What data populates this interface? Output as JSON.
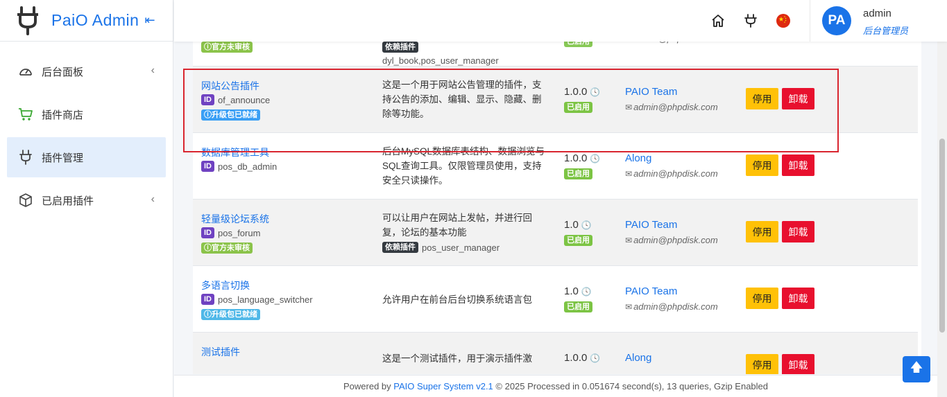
{
  "brand": {
    "title": "PaiO Admin",
    "collapse_icon": "collapse-left-icon"
  },
  "sidebar": {
    "items": [
      {
        "label": "后台面板",
        "icon": "dashboard-icon",
        "has_chevron": true
      },
      {
        "label": "插件商店",
        "icon": "cart-icon",
        "has_chevron": false
      },
      {
        "label": "插件管理",
        "icon": "plug-icon",
        "has_chevron": false,
        "active": true
      },
      {
        "label": "已启用插件",
        "icon": "box-icon",
        "has_chevron": true
      }
    ]
  },
  "header": {
    "icons": [
      "home-icon",
      "plug-icon",
      "china-flag-icon"
    ],
    "user": {
      "avatar_text": "PA",
      "name": "admin",
      "role": "后台管理员"
    }
  },
  "plugins": {
    "top_partial": {
      "review_badge": "ⓘ官方未审核",
      "dep_badge": "依赖插件",
      "dep_value": "dyl_book,pos_user_manager"
    },
    "labels": {
      "id_badge": "ID",
      "dep_badge": "依赖插件",
      "enabled_badge": "已启用",
      "disable_btn": "停用",
      "uninstall_btn": "卸载",
      "email_icon": "envelope-icon",
      "clock_icon": "clock-icon"
    },
    "rows": [
      {
        "name": "网站公告插件",
        "id": "of_announce",
        "status_badge": "ⓘ升级包已就绪",
        "description": "这是一个用于网站公告管理的插件，支持公告的添加、编辑、显示、隐藏、删除等功能。",
        "dependency": "",
        "version": "1.0.0",
        "author": "PAIO Team",
        "email": "admin@phpdisk.com"
      },
      {
        "name": "数据库管理工具",
        "id": "pos_db_admin",
        "status_badge": "",
        "description": "后台MySQL数据库表结构、数据浏览与SQL查询工具。仅限管理员使用，支持安全只读操作。",
        "dependency": "",
        "version": "1.0.0",
        "author": "Along",
        "email": "admin@phpdisk.com"
      },
      {
        "name": "轻量级论坛系统",
        "id": "pos_forum",
        "status_badge": "ⓘ官方未审核",
        "description": "可以让用户在网站上发帖，并进行回复，论坛的基本功能",
        "dependency": "pos_user_manager",
        "version": "1.0",
        "author": "PAIO Team",
        "email": "admin@phpdisk.com"
      },
      {
        "name": "多语言切换",
        "id": "pos_language_switcher",
        "status_badge": "ⓘ升级包已就绪",
        "description": "允许用户在前台后台切换系统语言包",
        "dependency": "",
        "version": "1.0",
        "author": "PAIO Team",
        "email": "admin@phpdisk.com"
      },
      {
        "name": "测试插件",
        "id": "",
        "status_badge": "",
        "description": "这是一个测试插件，用于演示插件激",
        "dependency": "",
        "version": "1.0.0",
        "author": "Along",
        "email": ""
      }
    ]
  },
  "footer": {
    "prefix": "Powered by ",
    "link": "PAIO Super System v2.1",
    "suffix": " © 2025 Processed in 0.051674 second(s), 13 queries, Gzip Enabled"
  },
  "colors": {
    "accent": "#1a73e8",
    "warning": "#ffc107",
    "danger": "#e8102e",
    "success": "#7cc444",
    "highlight": "#d9252f"
  }
}
